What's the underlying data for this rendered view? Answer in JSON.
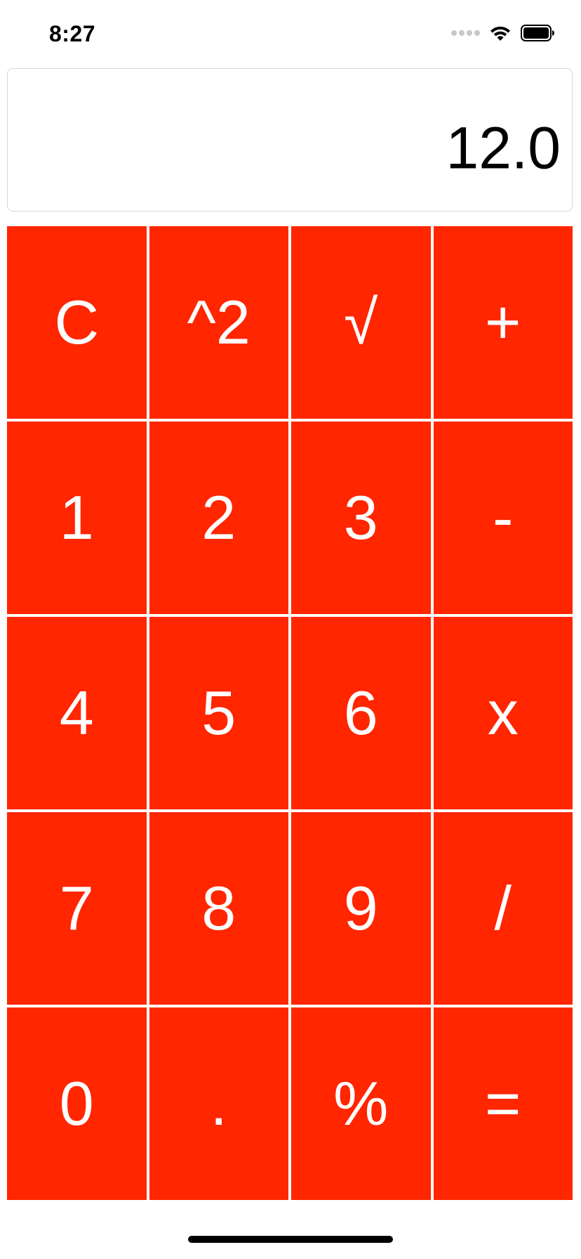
{
  "status_bar": {
    "time": "8:27",
    "icons": [
      "signal-dots-icon",
      "wifi-icon",
      "battery-icon"
    ]
  },
  "display": {
    "value": "12.0"
  },
  "keypad": {
    "keys": [
      {
        "label": "C",
        "name": "clear"
      },
      {
        "label": "^2",
        "name": "square"
      },
      {
        "label": "√",
        "name": "square-root"
      },
      {
        "label": "+",
        "name": "add"
      },
      {
        "label": "1",
        "name": "digit-1"
      },
      {
        "label": "2",
        "name": "digit-2"
      },
      {
        "label": "3",
        "name": "digit-3"
      },
      {
        "label": "-",
        "name": "subtract"
      },
      {
        "label": "4",
        "name": "digit-4"
      },
      {
        "label": "5",
        "name": "digit-5"
      },
      {
        "label": "6",
        "name": "digit-6"
      },
      {
        "label": "x",
        "name": "multiply"
      },
      {
        "label": "7",
        "name": "digit-7"
      },
      {
        "label": "8",
        "name": "digit-8"
      },
      {
        "label": "9",
        "name": "digit-9"
      },
      {
        "label": "/",
        "name": "divide"
      },
      {
        "label": "0",
        "name": "digit-0"
      },
      {
        "label": ".",
        "name": "decimal-point"
      },
      {
        "label": "%",
        "name": "percent"
      },
      {
        "label": "=",
        "name": "equals"
      }
    ]
  },
  "colors": {
    "key_background": "#ff2600",
    "key_text": "#ffffff",
    "display_text": "#000000",
    "display_border": "#d6d6d6"
  }
}
